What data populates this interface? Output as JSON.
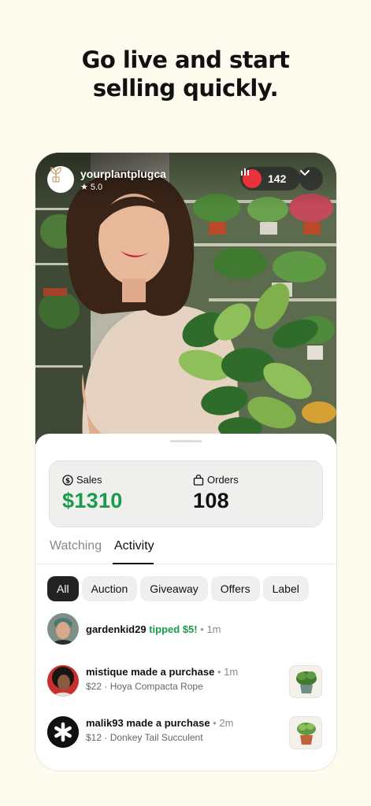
{
  "headline": {
    "line1": "Go live and start",
    "line2": "selling quickly."
  },
  "stream": {
    "host_name": "yourplantplugca",
    "rating": "5.0",
    "viewer_count": "142",
    "live_color": "#e8323c"
  },
  "stats": {
    "sales_label": "Sales",
    "sales_value": "$1310",
    "orders_label": "Orders",
    "orders_value": "108",
    "sales_color": "#1a9a4c"
  },
  "tabs": [
    {
      "label": "Watching",
      "active": false
    },
    {
      "label": "Activity",
      "active": true
    }
  ],
  "filters": [
    {
      "label": "All",
      "active": true
    },
    {
      "label": "Auction",
      "active": false
    },
    {
      "label": "Giveaway",
      "active": false
    },
    {
      "label": "Offers",
      "active": false
    },
    {
      "label": "Label",
      "active": false
    }
  ],
  "activity": [
    {
      "user": "gardenkid29",
      "action": "tipped $5!",
      "separator": "•",
      "time": "1m",
      "detail": ""
    },
    {
      "user": "mistique",
      "action": "made a purchase",
      "separator": "•",
      "time": "1m",
      "price": "$22",
      "product": "Hoya Compacta Rope"
    },
    {
      "user": "malik93",
      "action": "made a purchase",
      "separator": "•",
      "time": "2m",
      "price": "$12",
      "product": "Donkey Tail Succulent"
    }
  ],
  "detail_separator": "·"
}
